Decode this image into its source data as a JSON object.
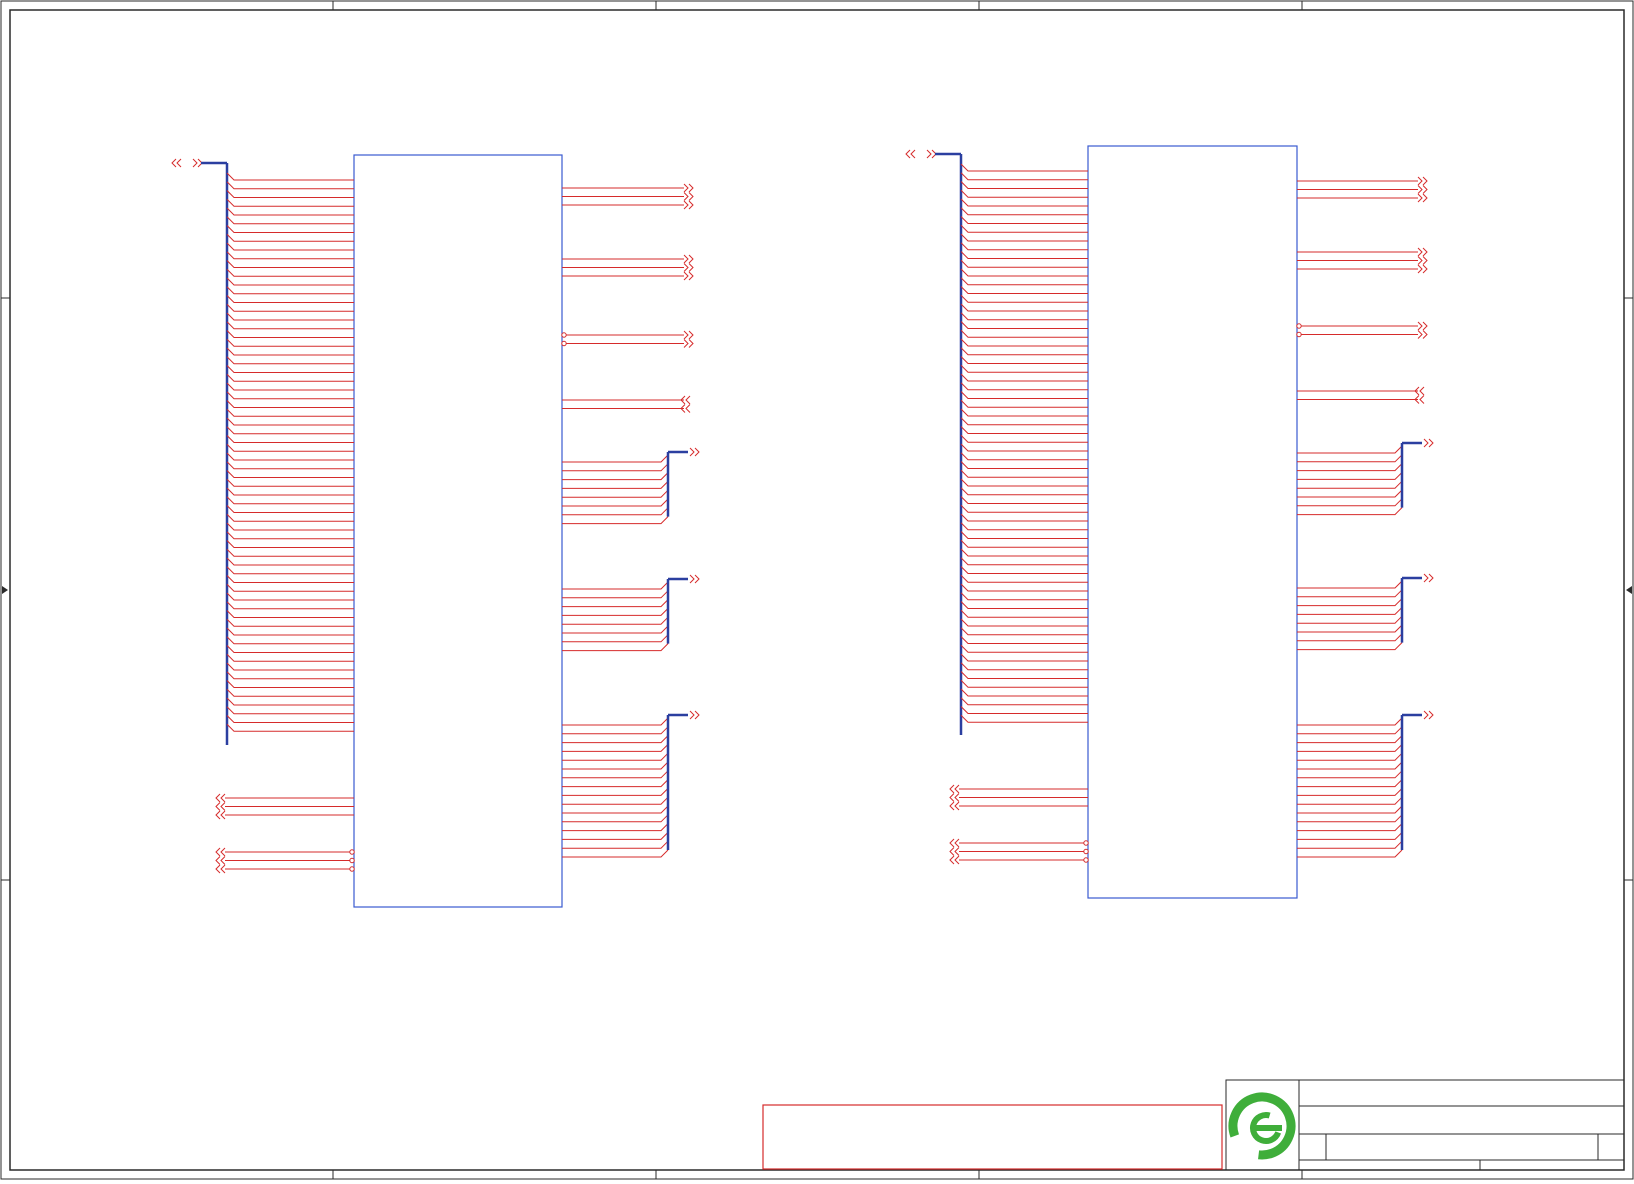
{
  "document": {
    "type": "schematic-sheet",
    "title_block": {
      "logo": "green-e-logo",
      "title": "",
      "sheet": ""
    },
    "note_box_text": ""
  },
  "colors": {
    "border": "#2a2a2a",
    "component": "#3a5bd0",
    "wire": "#d62b2b",
    "bus": "#2b3fa0",
    "logo_green": "#3fae3a",
    "note_box": "#d62b2b"
  },
  "components": [
    {
      "name": "left-ic",
      "left_pin_count": 64,
      "left_input_groups": [
        {
          "pins": 3,
          "marker": "inverted-bubble-none"
        },
        {
          "pins": 3,
          "marker": "bubble"
        }
      ],
      "right_groups": [
        {
          "pins": 3,
          "type": "arrow-out"
        },
        {
          "pins": 3,
          "type": "arrow-out"
        },
        {
          "pins": 2,
          "type": "arrow-out",
          "marker": "bubble"
        },
        {
          "pins": 2,
          "type": "arrow-in"
        },
        {
          "pins": 8,
          "type": "bus"
        },
        {
          "pins": 8,
          "type": "bus"
        },
        {
          "pins": 16,
          "type": "bus"
        }
      ]
    },
    {
      "name": "right-ic",
      "left_pin_count": 64,
      "left_input_groups": [
        {
          "pins": 3,
          "marker": "none"
        },
        {
          "pins": 3,
          "marker": "bubble"
        }
      ],
      "right_groups": [
        {
          "pins": 3,
          "type": "arrow-out"
        },
        {
          "pins": 3,
          "type": "arrow-out"
        },
        {
          "pins": 2,
          "type": "arrow-out",
          "marker": "bubble"
        },
        {
          "pins": 2,
          "type": "arrow-in"
        },
        {
          "pins": 8,
          "type": "bus"
        },
        {
          "pins": 8,
          "type": "bus"
        },
        {
          "pins": 16,
          "type": "bus"
        }
      ]
    }
  ]
}
